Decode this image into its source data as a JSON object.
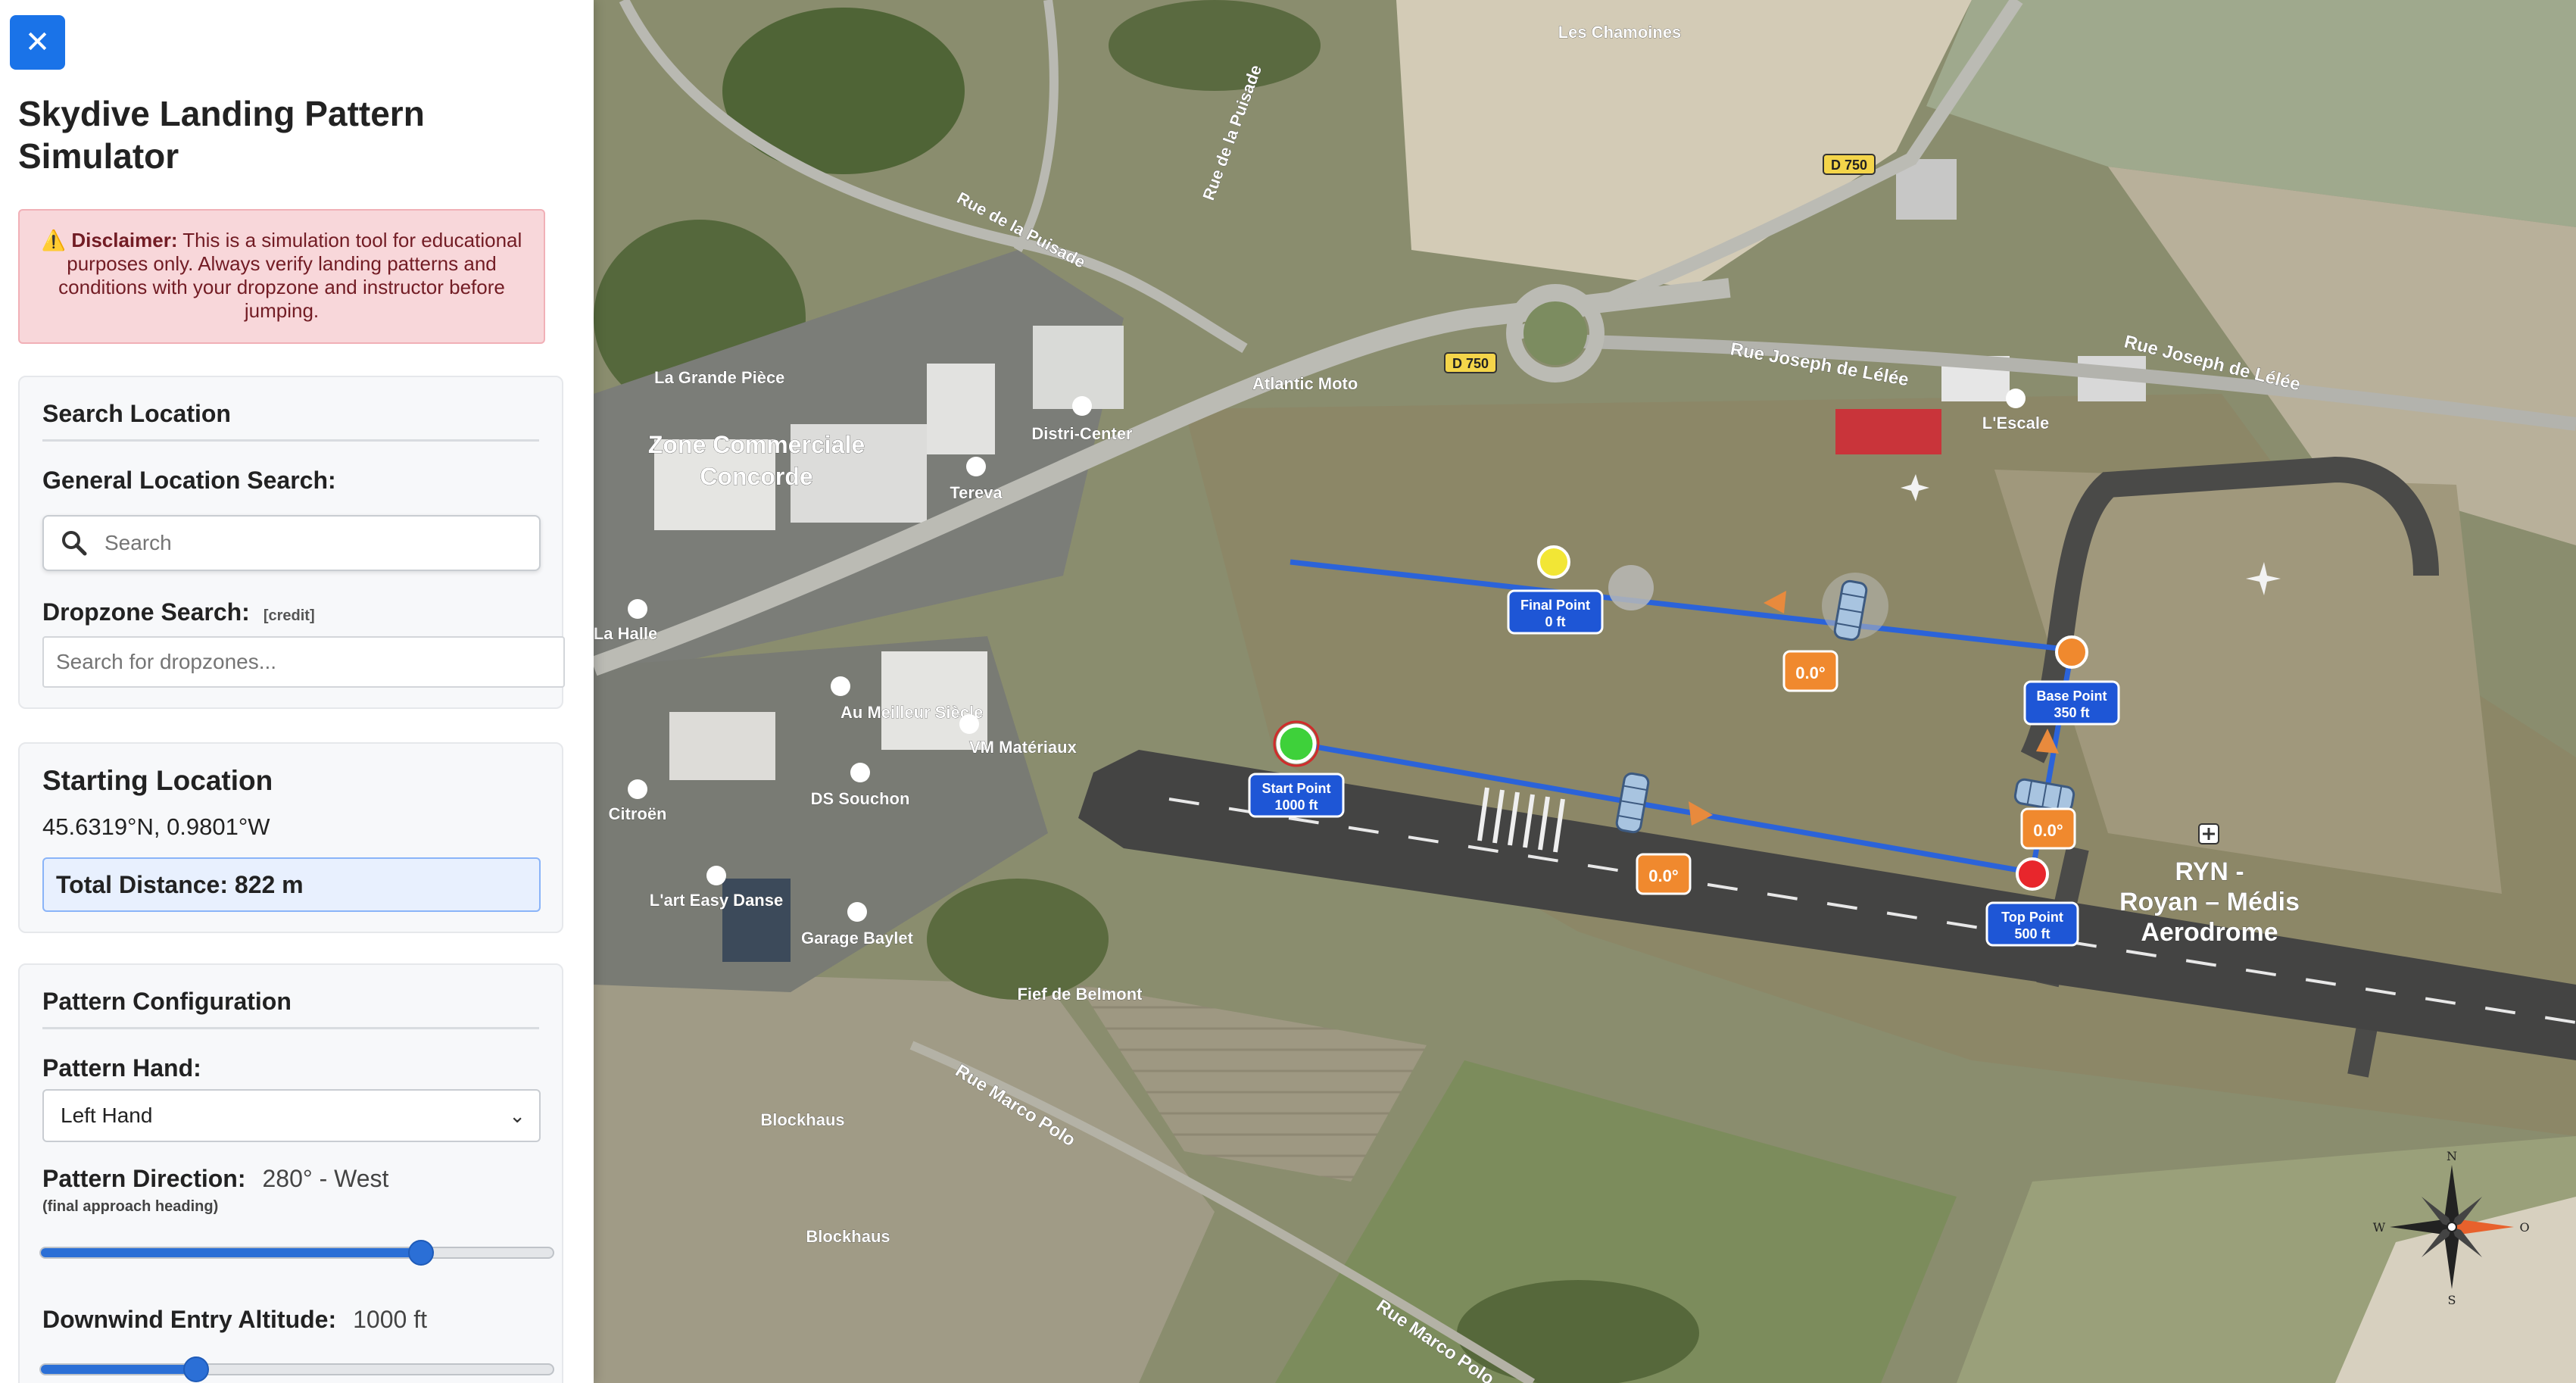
{
  "sidebar": {
    "close_label": "✕",
    "title": "Skydive Landing Pattern Simulator",
    "disclaimer": {
      "icon": "⚠️",
      "label": "Disclaimer:",
      "text": "This is a simulation tool for educational purposes only. Always verify landing patterns and conditions with your dropzone and instructor before jumping."
    },
    "search": {
      "section_title": "Search Location",
      "general_label": "General Location Search:",
      "general_placeholder": "Search",
      "dropzone_label": "Dropzone Search:",
      "dropzone_credit": "[credit]",
      "dropzone_placeholder": "Search for dropzones..."
    },
    "starting": {
      "section_title": "Starting Location",
      "coords": "45.6319°N, 0.9801°W",
      "distance": "Total Distance: 822 m"
    },
    "pattern": {
      "section_title": "Pattern Configuration",
      "hand_label": "Pattern Hand:",
      "hand_value": "Left Hand",
      "direction_label": "Pattern Direction:",
      "direction_value": "280° - West",
      "direction_note": "(final approach heading)",
      "direction_fraction": 0.74,
      "downwind_label": "Downwind Entry Altitude:",
      "downwind_value": "1000 ft",
      "downwind_fraction": 0.3
    }
  },
  "map": {
    "place_labels": {
      "les_chamoines": "Les Chamoines",
      "rue_puisade_1": "Rue de la Puisade",
      "rue_puisade_2": "Rue de la Puisade",
      "d750_a": "D 750",
      "d750_b": "D 750",
      "rue_joseph_1": "Rue Joseph de Lélée",
      "rue_joseph_2": "Rue Joseph de Lélée",
      "la_grande_piece": "La Grande Pièce",
      "zone_commerciale": "Zone Commerciale",
      "concorde": "Concorde",
      "distri_center": "Distri-Center",
      "atlantic_moto": "Atlantic Moto",
      "tereva": "Tereva",
      "lescale": "L'Escale",
      "la_halle": "La Halle",
      "au_meilleur": "Au Meilleur Siècle",
      "vm_materiaux": "VM Matériaux",
      "ds_souchon": "DS Souchon",
      "citroen": "Citroën",
      "lart_easy": "L'art Easy Danse",
      "garage_baylet": "Garage Baylet",
      "fief_belmont": "Fief de Belmont",
      "rue_marco_1": "Rue Marco Polo",
      "rue_marco_2": "Rue Marco Polo",
      "blockhaus_1": "Blockhaus",
      "blockhaus_2": "Blockhaus",
      "ryn_1": "RYN -",
      "ryn_2": "Royan – Médis",
      "ryn_3": "Aerodrome"
    },
    "points": {
      "final": {
        "name": "Final Point",
        "alt": "0 ft",
        "color": "#f2e635"
      },
      "base": {
        "name": "Base Point",
        "alt": "350 ft",
        "color": "#f0892e"
      },
      "start": {
        "name": "Start Point",
        "alt": "1000 ft",
        "color": "#3ed13a"
      },
      "top": {
        "name": "Top Point",
        "alt": "500 ft",
        "color": "#e8262c"
      }
    },
    "angle_badges": [
      "0.0°",
      "0.0°",
      "0.0°"
    ],
    "compass": {
      "n": "N",
      "s": "S",
      "e": "O",
      "w": "W"
    },
    "colors": {
      "path": "#2b63d9",
      "badge": "#f0892e",
      "label": "#1e56d6"
    }
  }
}
